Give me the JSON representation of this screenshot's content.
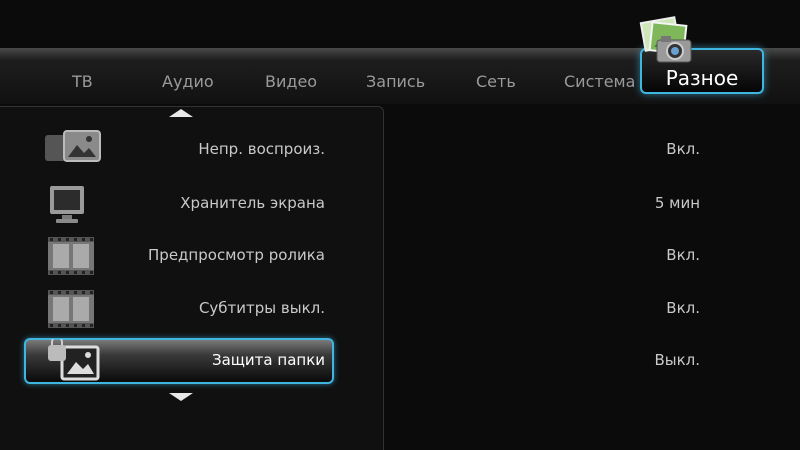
{
  "tabs": [
    {
      "label": "ТВ"
    },
    {
      "label": "Аудио"
    },
    {
      "label": "Видео"
    },
    {
      "label": "Запись"
    },
    {
      "label": "Сеть"
    },
    {
      "label": "Система"
    }
  ],
  "active_tab": {
    "label": "Разное",
    "icon": "camera-photos-icon"
  },
  "settings": [
    {
      "label": "Непр. воспроиз.",
      "value": "Вкл.",
      "icon": "picture-icon"
    },
    {
      "label": "Хранитель экрана",
      "value": "5 мин",
      "icon": "monitor-icon"
    },
    {
      "label": "Предпросмотр ролика",
      "value": "Вкл.",
      "icon": "film-icon"
    },
    {
      "label": "Субтитры выкл.",
      "value": "Вкл.",
      "icon": "film-icon"
    },
    {
      "label": "Защита папки",
      "value": "Выкл.",
      "icon": "picture-lock-icon"
    }
  ],
  "colors": {
    "accent": "#3fb6e0",
    "background": "#0b0b0b",
    "text": "#c9c9c9"
  }
}
